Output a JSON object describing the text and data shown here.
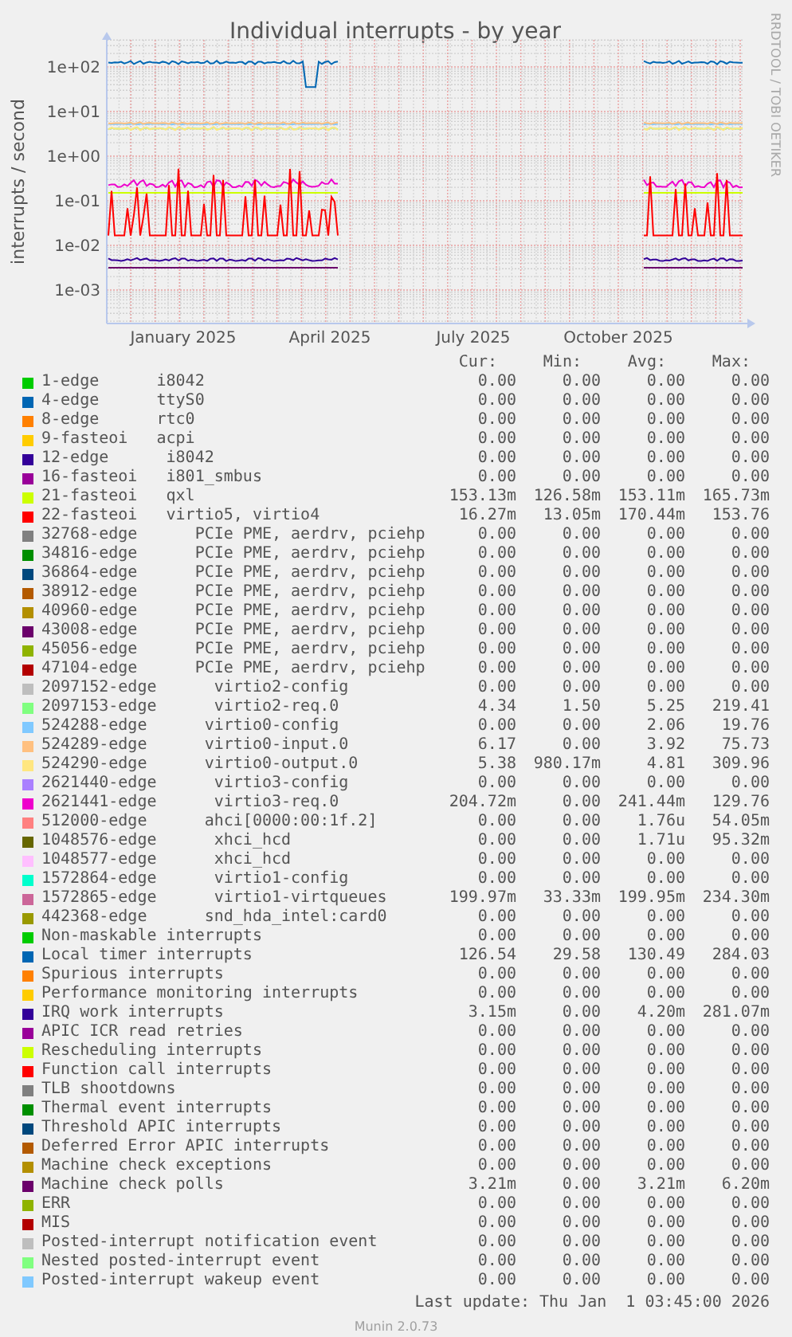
{
  "chart": {
    "title": "Individual interrupts - by year",
    "vertical_credit": "RRDTOOL / TOBI OETIKER",
    "y_axis_label": "interrupts / second",
    "y_tick_labels": [
      "1e+02",
      "1e+01",
      "1e+00",
      "1e-01",
      "1e-02",
      "1e-03"
    ],
    "x_tick_labels": [
      "January 2025",
      "April 2025",
      "July 2025",
      "October 2025"
    ]
  },
  "legend": {
    "columns": [
      "Cur:",
      "Min:",
      "Avg:",
      "Max:"
    ],
    "rows": [
      {
        "label": "1-edge      i8042",
        "color": "#00cc00",
        "cur": "0.00",
        "min": "0.00",
        "avg": "0.00",
        "max": "0.00"
      },
      {
        "label": "4-edge      ttyS0",
        "color": "#0066b3",
        "cur": "0.00",
        "min": "0.00",
        "avg": "0.00",
        "max": "0.00"
      },
      {
        "label": "8-edge      rtc0",
        "color": "#ff8000",
        "cur": "0.00",
        "min": "0.00",
        "avg": "0.00",
        "max": "0.00"
      },
      {
        "label": "9-fasteoi   acpi",
        "color": "#ffcc00",
        "cur": "0.00",
        "min": "0.00",
        "avg": "0.00",
        "max": "0.00"
      },
      {
        "label": "12-edge      i8042",
        "color": "#330099",
        "cur": "0.00",
        "min": "0.00",
        "avg": "0.00",
        "max": "0.00"
      },
      {
        "label": "16-fasteoi   i801_smbus",
        "color": "#990099",
        "cur": "0.00",
        "min": "0.00",
        "avg": "0.00",
        "max": "0.00"
      },
      {
        "label": "21-fasteoi   qxl",
        "color": "#ccff00",
        "cur": "153.13m",
        "min": "126.58m",
        "avg": "153.11m",
        "max": "165.73m"
      },
      {
        "label": "22-fasteoi   virtio5, virtio4",
        "color": "#ff0000",
        "cur": "16.27m",
        "min": "13.05m",
        "avg": "170.44m",
        "max": "153.76"
      },
      {
        "label": "32768-edge      PCIe PME, aerdrv, pciehp",
        "color": "#808080",
        "cur": "0.00",
        "min": "0.00",
        "avg": "0.00",
        "max": "0.00"
      },
      {
        "label": "34816-edge      PCIe PME, aerdrv, pciehp",
        "color": "#008f00",
        "cur": "0.00",
        "min": "0.00",
        "avg": "0.00",
        "max": "0.00"
      },
      {
        "label": "36864-edge      PCIe PME, aerdrv, pciehp",
        "color": "#00487d",
        "cur": "0.00",
        "min": "0.00",
        "avg": "0.00",
        "max": "0.00"
      },
      {
        "label": "38912-edge      PCIe PME, aerdrv, pciehp",
        "color": "#b35a00",
        "cur": "0.00",
        "min": "0.00",
        "avg": "0.00",
        "max": "0.00"
      },
      {
        "label": "40960-edge      PCIe PME, aerdrv, pciehp",
        "color": "#b38f00",
        "cur": "0.00",
        "min": "0.00",
        "avg": "0.00",
        "max": "0.00"
      },
      {
        "label": "43008-edge      PCIe PME, aerdrv, pciehp",
        "color": "#6b006b",
        "cur": "0.00",
        "min": "0.00",
        "avg": "0.00",
        "max": "0.00"
      },
      {
        "label": "45056-edge      PCIe PME, aerdrv, pciehp",
        "color": "#8fb300",
        "cur": "0.00",
        "min": "0.00",
        "avg": "0.00",
        "max": "0.00"
      },
      {
        "label": "47104-edge      PCIe PME, aerdrv, pciehp",
        "color": "#b30000",
        "cur": "0.00",
        "min": "0.00",
        "avg": "0.00",
        "max": "0.00"
      },
      {
        "label": "2097152-edge      virtio2-config",
        "color": "#bebebe",
        "cur": "0.00",
        "min": "0.00",
        "avg": "0.00",
        "max": "0.00"
      },
      {
        "label": "2097153-edge      virtio2-req.0",
        "color": "#80ff80",
        "cur": "4.34",
        "min": "1.50",
        "avg": "5.25",
        "max": "219.41"
      },
      {
        "label": "524288-edge      virtio0-config",
        "color": "#80c9ff",
        "cur": "0.00",
        "min": "0.00",
        "avg": "2.06",
        "max": "19.76"
      },
      {
        "label": "524289-edge      virtio0-input.0",
        "color": "#ffc080",
        "cur": "6.17",
        "min": "0.00",
        "avg": "3.92",
        "max": "75.73"
      },
      {
        "label": "524290-edge      virtio0-output.0",
        "color": "#ffe680",
        "cur": "5.38",
        "min": "980.17m",
        "avg": "4.81",
        "max": "309.96"
      },
      {
        "label": "2621440-edge      virtio3-config",
        "color": "#aa80ff",
        "cur": "0.00",
        "min": "0.00",
        "avg": "0.00",
        "max": "0.00"
      },
      {
        "label": "2621441-edge      virtio3-req.0",
        "color": "#ee00cc",
        "cur": "204.72m",
        "min": "0.00",
        "avg": "241.44m",
        "max": "129.76"
      },
      {
        "label": "512000-edge      ahci[0000:00:1f.2]",
        "color": "#ff8080",
        "cur": "0.00",
        "min": "0.00",
        "avg": "1.76u",
        "max": "54.05m"
      },
      {
        "label": "1048576-edge      xhci_hcd",
        "color": "#666600",
        "cur": "0.00",
        "min": "0.00",
        "avg": "1.71u",
        "max": "95.32m"
      },
      {
        "label": "1048577-edge      xhci_hcd",
        "color": "#ffbfff",
        "cur": "0.00",
        "min": "0.00",
        "avg": "0.00",
        "max": "0.00"
      },
      {
        "label": "1572864-edge      virtio1-config",
        "color": "#00ffcc",
        "cur": "0.00",
        "min": "0.00",
        "avg": "0.00",
        "max": "0.00"
      },
      {
        "label": "1572865-edge      virtio1-virtqueues",
        "color": "#cc6699",
        "cur": "199.97m",
        "min": "33.33m",
        "avg": "199.95m",
        "max": "234.30m"
      },
      {
        "label": "442368-edge      snd_hda_intel:card0",
        "color": "#999900",
        "cur": "0.00",
        "min": "0.00",
        "avg": "0.00",
        "max": "0.00"
      },
      {
        "label": "Non-maskable interrupts",
        "color": "#00cc00",
        "cur": "0.00",
        "min": "0.00",
        "avg": "0.00",
        "max": "0.00"
      },
      {
        "label": "Local timer interrupts",
        "color": "#0066b3",
        "cur": "126.54",
        "min": "29.58",
        "avg": "130.49",
        "max": "284.03"
      },
      {
        "label": "Spurious interrupts",
        "color": "#ff8000",
        "cur": "0.00",
        "min": "0.00",
        "avg": "0.00",
        "max": "0.00"
      },
      {
        "label": "Performance monitoring interrupts",
        "color": "#ffcc00",
        "cur": "0.00",
        "min": "0.00",
        "avg": "0.00",
        "max": "0.00"
      },
      {
        "label": "IRQ work interrupts",
        "color": "#330099",
        "cur": "3.15m",
        "min": "0.00",
        "avg": "4.20m",
        "max": "281.07m"
      },
      {
        "label": "APIC ICR read retries",
        "color": "#990099",
        "cur": "0.00",
        "min": "0.00",
        "avg": "0.00",
        "max": "0.00"
      },
      {
        "label": "Rescheduling interrupts",
        "color": "#ccff00",
        "cur": "0.00",
        "min": "0.00",
        "avg": "0.00",
        "max": "0.00"
      },
      {
        "label": "Function call interrupts",
        "color": "#ff0000",
        "cur": "0.00",
        "min": "0.00",
        "avg": "0.00",
        "max": "0.00"
      },
      {
        "label": "TLB shootdowns",
        "color": "#808080",
        "cur": "0.00",
        "min": "0.00",
        "avg": "0.00",
        "max": "0.00"
      },
      {
        "label": "Thermal event interrupts",
        "color": "#008f00",
        "cur": "0.00",
        "min": "0.00",
        "avg": "0.00",
        "max": "0.00"
      },
      {
        "label": "Threshold APIC interrupts",
        "color": "#00487d",
        "cur": "0.00",
        "min": "0.00",
        "avg": "0.00",
        "max": "0.00"
      },
      {
        "label": "Deferred Error APIC interrupts",
        "color": "#b35a00",
        "cur": "0.00",
        "min": "0.00",
        "avg": "0.00",
        "max": "0.00"
      },
      {
        "label": "Machine check exceptions",
        "color": "#b38f00",
        "cur": "0.00",
        "min": "0.00",
        "avg": "0.00",
        "max": "0.00"
      },
      {
        "label": "Machine check polls",
        "color": "#6b006b",
        "cur": "3.21m",
        "min": "0.00",
        "avg": "3.21m",
        "max": "6.20m"
      },
      {
        "label": "ERR",
        "color": "#8fb300",
        "cur": "0.00",
        "min": "0.00",
        "avg": "0.00",
        "max": "0.00"
      },
      {
        "label": "MIS",
        "color": "#b30000",
        "cur": "0.00",
        "min": "0.00",
        "avg": "0.00",
        "max": "0.00"
      },
      {
        "label": "Posted-interrupt notification event",
        "color": "#bebebe",
        "cur": "0.00",
        "min": "0.00",
        "avg": "0.00",
        "max": "0.00"
      },
      {
        "label": "Nested posted-interrupt event",
        "color": "#80ff80",
        "cur": "0.00",
        "min": "0.00",
        "avg": "0.00",
        "max": "0.00"
      },
      {
        "label": "Posted-interrupt wakeup event",
        "color": "#80c9ff",
        "cur": "0.00",
        "min": "0.00",
        "avg": "0.00",
        "max": "0.00"
      }
    ]
  },
  "last_update": "Last update: Thu Jan  1 03:45:00 2026",
  "footer": "Munin 2.0.73"
}
